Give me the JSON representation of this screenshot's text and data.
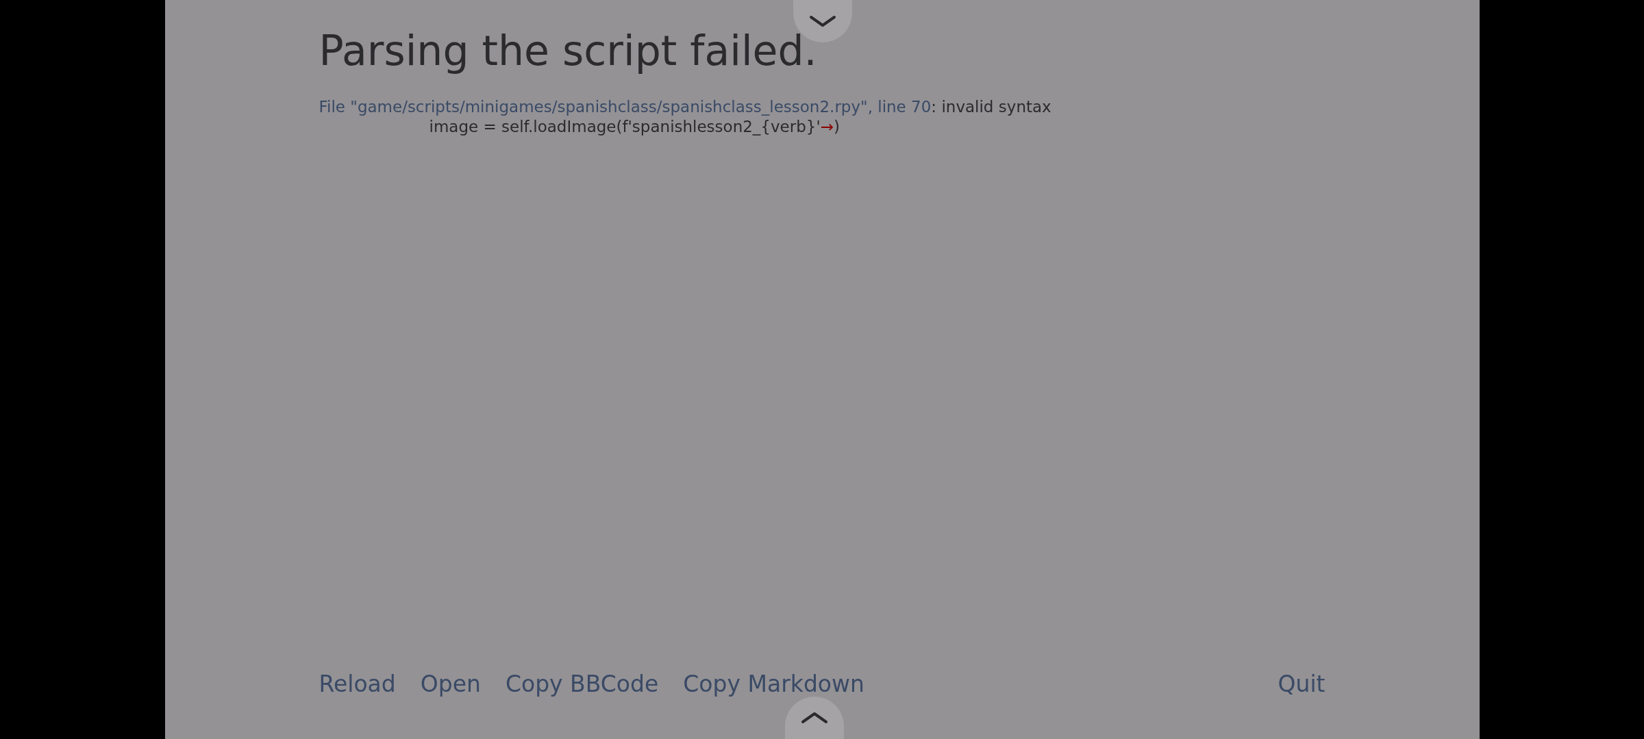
{
  "title": "Parsing the script failed.",
  "error": {
    "location": "File \"game/scripts/minigames/spanishclass/spanishclass_lesson2.rpy\", line 70",
    "message": ": invalid syntax",
    "code_before": "image = self.loadImage(f'spanishlesson2_{verb}'",
    "marker": "→",
    "code_after": ")"
  },
  "actions": [
    "Reload",
    "Open",
    "Copy BBCode",
    "Copy Markdown"
  ],
  "quit": "Quit"
}
